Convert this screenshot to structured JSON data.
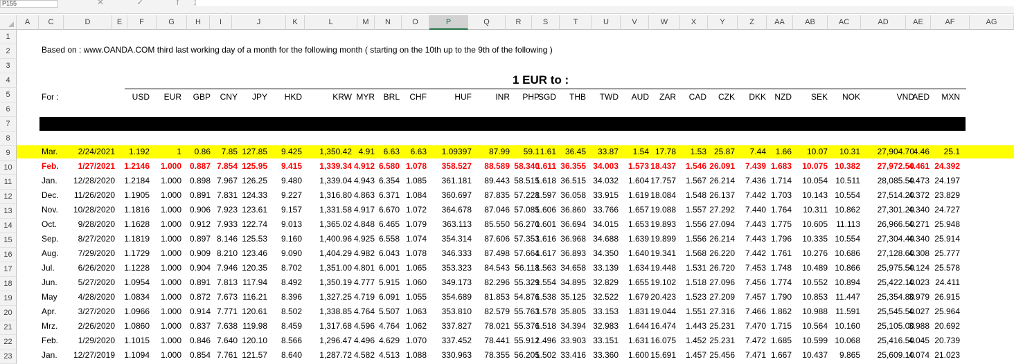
{
  "formula_bar": {
    "name_box": "P155",
    "fx_icons": "✕ ✓ fx"
  },
  "columns": [
    "A",
    "C",
    "D",
    "E",
    "F",
    "G",
    "H",
    "I",
    "J",
    "K",
    "L",
    "M",
    "N",
    "O",
    "P",
    "Q",
    "R",
    "S",
    "T",
    "U",
    "V",
    "W",
    "X",
    "Y",
    "Z",
    "AA",
    "AB",
    "AC",
    "AD",
    "AE",
    "AF",
    "AG"
  ],
  "active_column": "P",
  "rows": [
    "1",
    "2",
    "3",
    "4",
    "5",
    "6",
    "7",
    "8",
    "9",
    "10",
    "11",
    "12",
    "13",
    "14",
    "15",
    "16",
    "17",
    "18",
    "19",
    "20",
    "21",
    "22",
    "23"
  ],
  "note": "Based on : www.OANDA.COM third last working day of a month for the following month ( starting on the 10th up to the 9th of the following )",
  "title": "1 EUR to :",
  "for_label": "For :",
  "currencies": [
    "USD",
    "EUR",
    "GBP",
    "CNY",
    "JPY",
    "HKD",
    "KRW",
    "MYR",
    "BRL",
    "CHF",
    "HUF",
    "INR",
    "PHP",
    "SGD",
    "THB",
    "TWD",
    "AUD",
    "ZAR",
    "CAD",
    "CZK",
    "DKK",
    "NZD",
    "SEK",
    "NOK",
    "VND",
    "AED",
    "MXN"
  ],
  "data_rows": [
    {
      "month": "Mar.",
      "date": "2/24/2021",
      "values": [
        "1.192",
        "1",
        "0.86",
        "7.85",
        "127.85",
        "9.425",
        "1,350.42",
        "4.91",
        "6.63",
        "6.63",
        "1.09397",
        "87.99",
        "59.1",
        "1.61",
        "36.45",
        "33.87",
        "1.54",
        "17.78",
        "1.53",
        "25.87",
        "7.44",
        "1.66",
        "10.07",
        "10.31",
        "27,904.70",
        "4.46",
        "25.1"
      ]
    },
    {
      "month": "Feb.",
      "date": "1/27/2021",
      "values": [
        "1.2146",
        "1.000",
        "0.887",
        "7.854",
        "125.95",
        "9.415",
        "1,339.34",
        "4.912",
        "6.580",
        "1.078",
        "358.527",
        "88.589",
        "58.340",
        "1.611",
        "36.355",
        "34.003",
        "1.573",
        "18.437",
        "1.546",
        "26.091",
        "7.439",
        "1.683",
        "10.075",
        "10.382",
        "27,972.50",
        "4.461",
        "24.392"
      ]
    },
    {
      "month": "Jan.",
      "date": "12/28/2020",
      "values": [
        "1.2184",
        "1.000",
        "0.898",
        "7.967",
        "126.25",
        "9.480",
        "1,339.04",
        "4.943",
        "6.354",
        "1.085",
        "361.181",
        "89.443",
        "58.515",
        "1.618",
        "36.515",
        "34.032",
        "1.604",
        "17.757",
        "1.567",
        "26.214",
        "7.436",
        "1.714",
        "10.054",
        "10.511",
        "28,085.50",
        "4.473",
        "24.197"
      ]
    },
    {
      "month": "Dec.",
      "date": "11/26/2020",
      "values": [
        "1.1905",
        "1.000",
        "0.891",
        "7.831",
        "124.33",
        "9.227",
        "1,316.80",
        "4.863",
        "6.371",
        "1.084",
        "360.697",
        "87.835",
        "57.228",
        "1.597",
        "36.058",
        "33.915",
        "1.619",
        "18.084",
        "1.548",
        "26.137",
        "7.442",
        "1.703",
        "10.143",
        "10.554",
        "27,514.20",
        "4.372",
        "23.829"
      ]
    },
    {
      "month": "Nov.",
      "date": "10/28/2020",
      "values": [
        "1.1816",
        "1.000",
        "0.906",
        "7.923",
        "123.61",
        "9.157",
        "1,331.58",
        "4.917",
        "6.670",
        "1.072",
        "364.678",
        "87.046",
        "57.085",
        "1.606",
        "36.860",
        "33.766",
        "1.657",
        "19.088",
        "1.557",
        "27.292",
        "7.440",
        "1.764",
        "10.311",
        "10.862",
        "27,301.20",
        "4.340",
        "24.727"
      ]
    },
    {
      "month": "Oct.",
      "date": "9/28/2020",
      "values": [
        "1.1628",
        "1.000",
        "0.912",
        "7.933",
        "122.74",
        "9.013",
        "1,365.02",
        "4.848",
        "6.465",
        "1.079",
        "363.113",
        "85.550",
        "56.270",
        "1.601",
        "36.694",
        "34.015",
        "1.653",
        "19.893",
        "1.556",
        "27.094",
        "7.443",
        "1.775",
        "10.605",
        "11.113",
        "26,966.50",
        "4.271",
        "25.948"
      ]
    },
    {
      "month": "Sep.",
      "date": "8/27/2020",
      "values": [
        "1.1819",
        "1.000",
        "0.897",
        "8.146",
        "125.53",
        "9.160",
        "1,400.96",
        "4.925",
        "6.558",
        "1.074",
        "354.314",
        "87.606",
        "57.353",
        "1.616",
        "36.968",
        "34.688",
        "1.639",
        "19.899",
        "1.556",
        "26.214",
        "7.443",
        "1.796",
        "10.335",
        "10.554",
        "27,304.40",
        "4.340",
        "25.914"
      ]
    },
    {
      "month": "Aug.",
      "date": "7/29/2020",
      "values": [
        "1.1729",
        "1.000",
        "0.909",
        "8.210",
        "123.46",
        "9.090",
        "1,404.29",
        "4.982",
        "6.043",
        "1.078",
        "346.333",
        "87.498",
        "57.664",
        "1.617",
        "36.893",
        "34.350",
        "1.640",
        "19.341",
        "1.568",
        "26.220",
        "7.442",
        "1.761",
        "10.276",
        "10.686",
        "27,128.60",
        "4.308",
        "25.777"
      ]
    },
    {
      "month": "Jul.",
      "date": "6/26/2020",
      "values": [
        "1.1228",
        "1.000",
        "0.904",
        "7.946",
        "120.35",
        "8.702",
        "1,351.00",
        "4.801",
        "6.001",
        "1.065",
        "353.323",
        "84.543",
        "56.118",
        "1.563",
        "34.658",
        "33.139",
        "1.634",
        "19.448",
        "1.531",
        "26.720",
        "7.453",
        "1.748",
        "10.489",
        "10.866",
        "25,975.50",
        "4.124",
        "25.578"
      ]
    },
    {
      "month": "Jun.",
      "date": "5/27/2020",
      "values": [
        "1.0954",
        "1.000",
        "0.891",
        "7.813",
        "117.94",
        "8.492",
        "1,350.19",
        "4.777",
        "5.915",
        "1.060",
        "349.173",
        "82.296",
        "55.329",
        "1.554",
        "34.895",
        "32.829",
        "1.655",
        "19.102",
        "1.518",
        "27.096",
        "7.456",
        "1.774",
        "10.552",
        "10.894",
        "25,422.10",
        "4.023",
        "24.411"
      ]
    },
    {
      "month": "May",
      "date": "4/28/2020",
      "values": [
        "1.0834",
        "1.000",
        "0.872",
        "7.673",
        "116.21",
        "8.396",
        "1,327.25",
        "4.719",
        "6.091",
        "1.055",
        "354.689",
        "81.853",
        "54.876",
        "1.538",
        "35.125",
        "32.522",
        "1.679",
        "20.423",
        "1.523",
        "27.209",
        "7.457",
        "1.790",
        "10.853",
        "11.447",
        "25,354.80",
        "3.979",
        "26.915"
      ]
    },
    {
      "month": "Apr.",
      "date": "3/27/2020",
      "values": [
        "1.0966",
        "1.000",
        "0.914",
        "7.771",
        "120.61",
        "8.502",
        "1,338.85",
        "4.764",
        "5.507",
        "1.063",
        "353.810",
        "82.579",
        "55.763",
        "1.578",
        "35.805",
        "33.153",
        "1.831",
        "19.044",
        "1.551",
        "27.316",
        "7.466",
        "1.862",
        "10.988",
        "11.591",
        "25,545.50",
        "4.027",
        "25.964"
      ]
    },
    {
      "month": "Mrz.",
      "date": "2/26/2020",
      "values": [
        "1.0860",
        "1.000",
        "0.837",
        "7.638",
        "119.98",
        "8.459",
        "1,317.68",
        "4.596",
        "4.764",
        "1.062",
        "337.827",
        "78.021",
        "55.376",
        "1.518",
        "34.394",
        "32.983",
        "1.644",
        "16.474",
        "1.443",
        "25.231",
        "7.470",
        "1.715",
        "10.564",
        "10.160",
        "25,105.00",
        "3.988",
        "20.692"
      ]
    },
    {
      "month": "Feb.",
      "date": "1/29/2020",
      "values": [
        "1.1015",
        "1.000",
        "0.846",
        "7.640",
        "120.10",
        "8.566",
        "1,296.47",
        "4.496",
        "4.629",
        "1.070",
        "337.452",
        "78.441",
        "55.912",
        "1.496",
        "33.903",
        "33.151",
        "1.631",
        "16.075",
        "1.452",
        "25.231",
        "7.472",
        "1.685",
        "10.599",
        "10.068",
        "25,416.50",
        "4.045",
        "20.739"
      ]
    },
    {
      "month": "Jan.",
      "date": "12/27/2019",
      "values": [
        "1.1094",
        "1.000",
        "0.854",
        "7.761",
        "121.57",
        "8.640",
        "1,287.72",
        "4.582",
        "4.513",
        "1.088",
        "330.963",
        "78.355",
        "56.205",
        "1.502",
        "33.416",
        "33.360",
        "1.600",
        "15.691",
        "1.457",
        "25.456",
        "7.471",
        "1.667",
        "10.437",
        "9.865",
        "25,609.10",
        "4.074",
        "21.023"
      ]
    }
  ],
  "colors": {
    "highlight_row": "#ffff00",
    "current_row_text": "#ff0000",
    "black_bar": "#000000",
    "active_col_accent": "#217346"
  }
}
